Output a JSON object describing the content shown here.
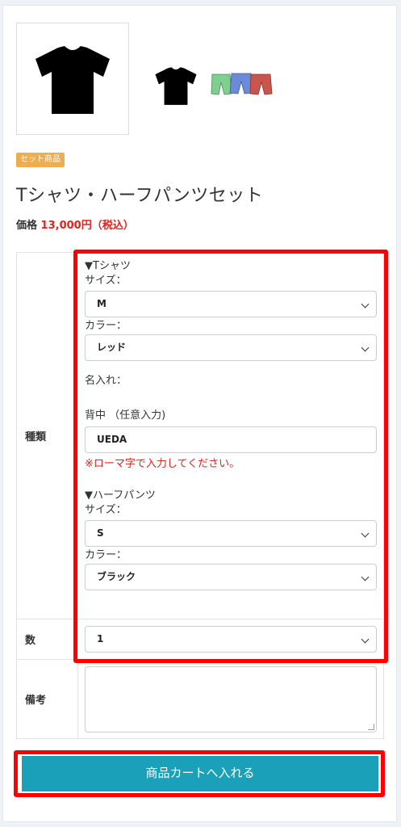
{
  "product": {
    "badge": "セット商品",
    "title": "Tシャツ・ハーフパンツセット",
    "price_label": "価格",
    "price_value": "13,000円（税込）"
  },
  "options": {
    "type_label": "種類",
    "tshirt_header": "▼Tシャツ",
    "tshirt_size_label": "サイズ：",
    "tshirt_size_value": "M",
    "tshirt_color_label": "カラー：",
    "tshirt_color_value": "レッド",
    "name_label": "名入れ：",
    "back_label": "背中 （任意入力)",
    "back_value": "UEDA",
    "romaji_note": "※ローマ字で入力してください。",
    "pants_header": "▼ハーフパンツ",
    "pants_size_label": "サイズ：",
    "pants_size_value": "S",
    "pants_color_label": "カラー：",
    "pants_color_value": "ブラック",
    "qty_label": "数",
    "qty_value": "1",
    "remarks_label": "備考"
  },
  "cart_button": "商品カートへ入れる",
  "colors": {
    "accent": "#1aa1b9",
    "price_red": "#e2231a",
    "badge": "#f0ad4e",
    "highlight": "#ff0000"
  },
  "icons": [
    "tshirt-icon",
    "shorts-icon",
    "chevron-down-icon"
  ]
}
